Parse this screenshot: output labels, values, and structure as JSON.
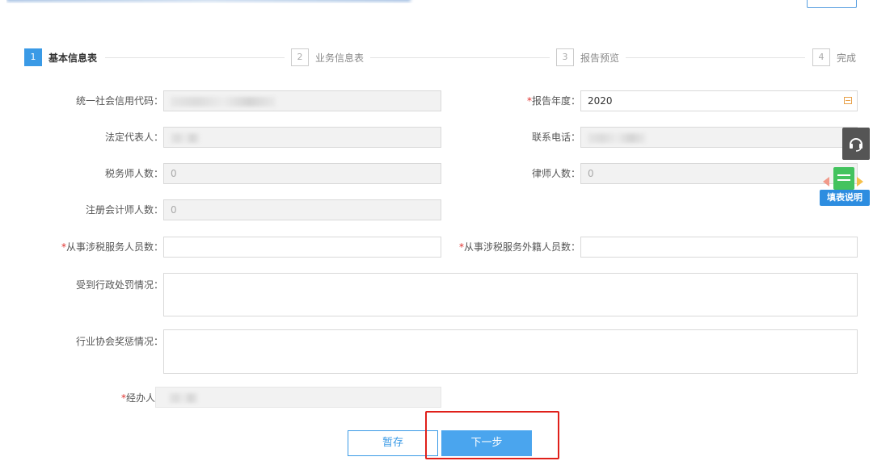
{
  "steps": [
    {
      "num": "1",
      "label": "基本信息表"
    },
    {
      "num": "2",
      "label": "业务信息表"
    },
    {
      "num": "3",
      "label": "报告预览"
    },
    {
      "num": "4",
      "label": "完成"
    }
  ],
  "form": {
    "credit_code_label": "统一社会信用代码：",
    "report_year_req": "*",
    "report_year_label": "报告年度：",
    "report_year_value": "2020",
    "legal_rep_label": "法定代表人：",
    "phone_label": "联系电话：",
    "tax_agents_label": "税务师人数：",
    "tax_agents_value": "0",
    "lawyers_label": "律师人数：",
    "lawyers_value": "0",
    "cpa_label": "注册会计师人数：",
    "cpa_value": "0",
    "staff_req": "*",
    "staff_label": "从事涉税服务人员数：",
    "foreign_staff_req": "*",
    "foreign_staff_label": "从事涉税服务外籍人员数：",
    "penalty_label": "受到行政处罚情况：",
    "award_label": "行业协会奖惩情况：",
    "handler_req": "*",
    "handler_label": "经办人"
  },
  "side": {
    "help_icon": "headset-icon",
    "guide_label": "填表说明"
  },
  "buttons": {
    "save_label": "暂存",
    "next_label": "下一步"
  },
  "colors": {
    "accent": "#3a9ae6",
    "required": "#e0322f",
    "highlight": "#e0201a",
    "guide_green": "#43c35e",
    "guide_blue": "#2d8de0"
  }
}
